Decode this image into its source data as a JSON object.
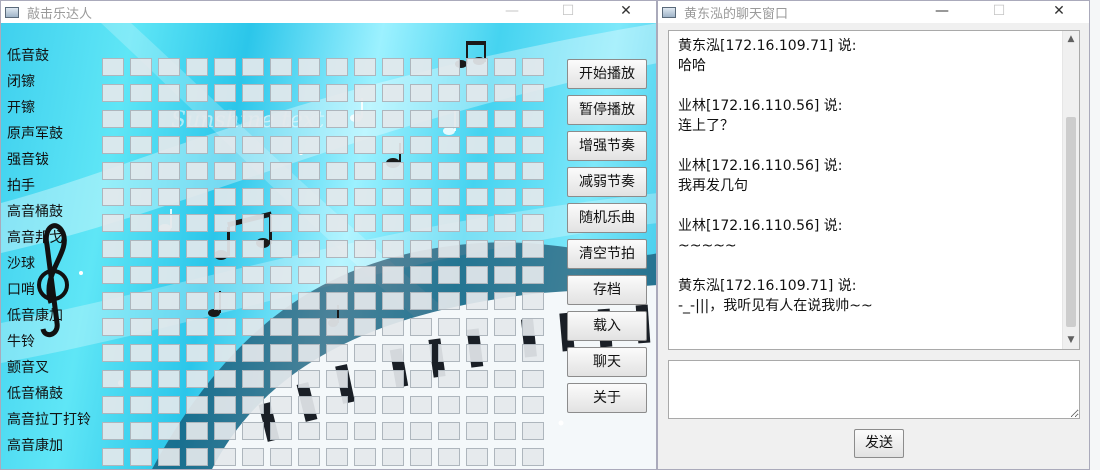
{
  "drum_window": {
    "title": "敲击乐达人",
    "controls": {
      "minimize": "—",
      "maximize": "☐",
      "close": "✕"
    },
    "instruments": [
      "低音鼓",
      "闭镲",
      "开镲",
      "原声军鼓",
      "强音钹",
      "拍手",
      "高音桶鼓",
      "高音邦戈",
      "沙球",
      "口哨",
      "低音康加",
      "牛铃",
      "颤音叉",
      "低音桶鼓",
      "高音拉丁打铃",
      "高音康加"
    ],
    "buttons": [
      "开始播放",
      "暂停播放",
      "增强节奏",
      "减弱节奏",
      "随机乐曲",
      "清空节拍",
      "存档",
      "载入",
      "聊天",
      "关于"
    ],
    "watermark": "Sunshine text"
  },
  "chat_window": {
    "title": "黄东泓的聊天窗口",
    "controls": {
      "minimize": "—",
      "maximize": "☐",
      "close": "✕"
    },
    "messages": [
      {
        "sender": "黄东泓[172.16.109.71] 说:",
        "text": "哈哈"
      },
      {
        "sender": "业林[172.16.110.56] 说:",
        "text": "连上了？"
      },
      {
        "sender": "业林[172.16.110.56] 说:",
        "text": "我再发几句"
      },
      {
        "sender": "业林[172.16.110.56] 说:",
        "text": "~~~~~"
      },
      {
        "sender": "黄东泓[172.16.109.71] 说:",
        "text": "-_-|||，我听见有人在说我帅~~"
      }
    ],
    "input_value": "",
    "send_label": "发送"
  }
}
